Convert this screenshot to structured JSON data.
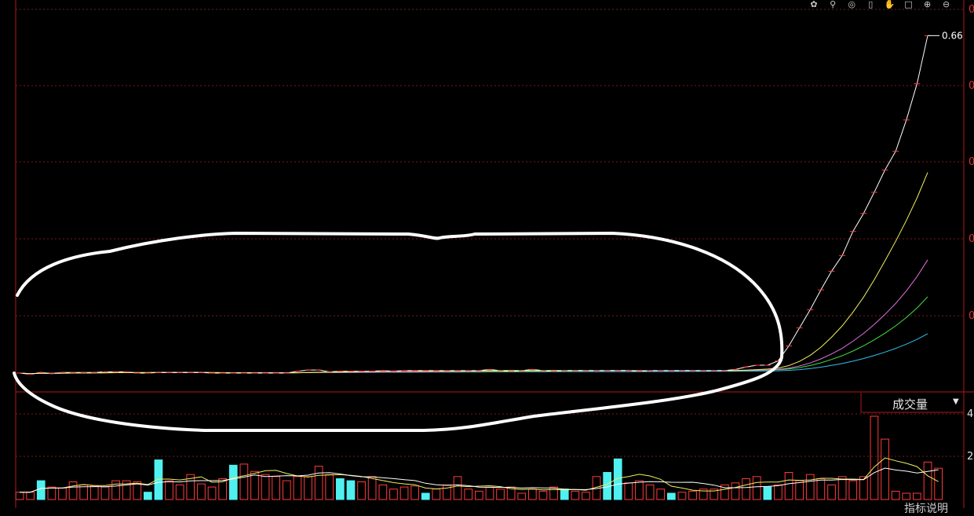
{
  "toolbar": {
    "icons": [
      "gear-icon",
      "search-icon",
      "target-icon",
      "save-icon",
      "hand-icon",
      "square-icon",
      "zoom-in-icon",
      "zoom-out-icon"
    ]
  },
  "price_panel": {
    "last_price_label": "0.66",
    "right_axis_labels": [
      "0",
      "0",
      "0",
      "0",
      "0"
    ],
    "colors": {
      "grid": "#7a1a1a",
      "axis": "#b01818",
      "candle_up": "#ff3a3a",
      "price_line": "#ffffff",
      "ma5": "#ffffff",
      "ma10": "#f0f060",
      "ma20": "#e070e0",
      "ma30": "#40e040",
      "ma60": "#30c0f0",
      "annotation": "#ffffff"
    }
  },
  "volume_panel": {
    "title": "成交量",
    "dropdown_arrow": "▼",
    "axis_labels": [
      "4",
      "2"
    ],
    "colors": {
      "up": "#ff3a3a",
      "down": "#50f0f0",
      "ma_a": "#f0f060",
      "ma_b": "#ffffff"
    }
  },
  "footer": {
    "partial_text": "指标说明"
  },
  "chart_data": {
    "type": "line",
    "price": [
      0.1,
      0.098,
      0.101,
      0.099,
      0.101,
      0.101,
      0.101,
      0.101,
      0.102,
      0.102,
      0.102,
      0.1,
      0.1,
      0.101,
      0.101,
      0.101,
      0.101,
      0.101,
      0.1,
      0.1,
      0.1,
      0.1,
      0.1,
      0.1,
      0.1,
      0.1,
      0.103,
      0.105,
      0.105,
      0.102,
      0.103,
      0.103,
      0.103,
      0.103,
      0.104,
      0.103,
      0.104,
      0.104,
      0.104,
      0.104,
      0.104,
      0.104,
      0.104,
      0.104,
      0.106,
      0.104,
      0.103,
      0.104,
      0.106,
      0.104,
      0.103,
      0.104,
      0.104,
      0.104,
      0.104,
      0.104,
      0.104,
      0.104,
      0.103,
      0.104,
      0.104,
      0.104,
      0.104,
      0.104,
      0.104,
      0.104,
      0.104,
      0.106,
      0.11,
      0.113,
      0.113,
      0.12,
      0.145,
      0.175,
      0.205,
      0.238,
      0.269,
      0.295,
      0.335,
      0.365,
      0.4,
      0.437,
      0.468,
      0.52,
      0.58,
      0.66
    ],
    "volume": [
      0.35,
      0.35,
      0.9,
      0.6,
      0.55,
      0.85,
      0.7,
      0.65,
      0.6,
      0.9,
      0.9,
      0.85,
      0.35,
      1.9,
      0.9,
      0.7,
      1.2,
      0.75,
      0.6,
      1.0,
      1.65,
      1.7,
      1.35,
      1.2,
      1.1,
      0.9,
      1.1,
      1.1,
      1.6,
      1.2,
      1.0,
      0.9,
      0.85,
      1.1,
      0.7,
      0.5,
      0.6,
      0.65,
      0.3,
      0.5,
      0.7,
      1.1,
      0.5,
      0.4,
      0.6,
      0.5,
      0.6,
      0.3,
      0.5,
      0.4,
      0.6,
      0.5,
      0.4,
      0.35,
      1.1,
      1.3,
      1.95,
      0.8,
      0.9,
      0.7,
      0.5,
      0.3,
      0.35,
      0.4,
      0.5,
      0.5,
      0.7,
      0.8,
      1.0,
      1.1,
      0.6,
      0.7,
      1.3,
      0.9,
      1.2,
      1.0,
      0.7,
      1.1,
      0.9,
      1.1,
      4.0,
      2.9,
      0.4,
      0.3,
      0.3,
      1.8,
      1.5
    ],
    "volume_up": [
      true,
      true,
      false,
      true,
      true,
      true,
      true,
      true,
      true,
      true,
      true,
      true,
      false,
      false,
      true,
      true,
      true,
      true,
      true,
      true,
      false,
      true,
      true,
      true,
      true,
      true,
      true,
      true,
      true,
      true,
      false,
      false,
      true,
      true,
      true,
      true,
      true,
      true,
      false,
      true,
      true,
      true,
      true,
      true,
      true,
      true,
      true,
      true,
      true,
      true,
      true,
      false,
      true,
      true,
      true,
      false,
      false,
      true,
      true,
      true,
      true,
      false,
      true,
      true,
      true,
      true,
      true,
      true,
      true,
      true,
      false,
      true,
      true,
      true,
      true,
      true,
      true,
      true,
      true,
      true,
      true,
      true,
      true,
      true,
      true,
      true,
      true
    ],
    "ylim_price": [
      0.07,
      0.68
    ],
    "ylim_volume": [
      0,
      4.3
    ],
    "last_label": "0.66"
  }
}
